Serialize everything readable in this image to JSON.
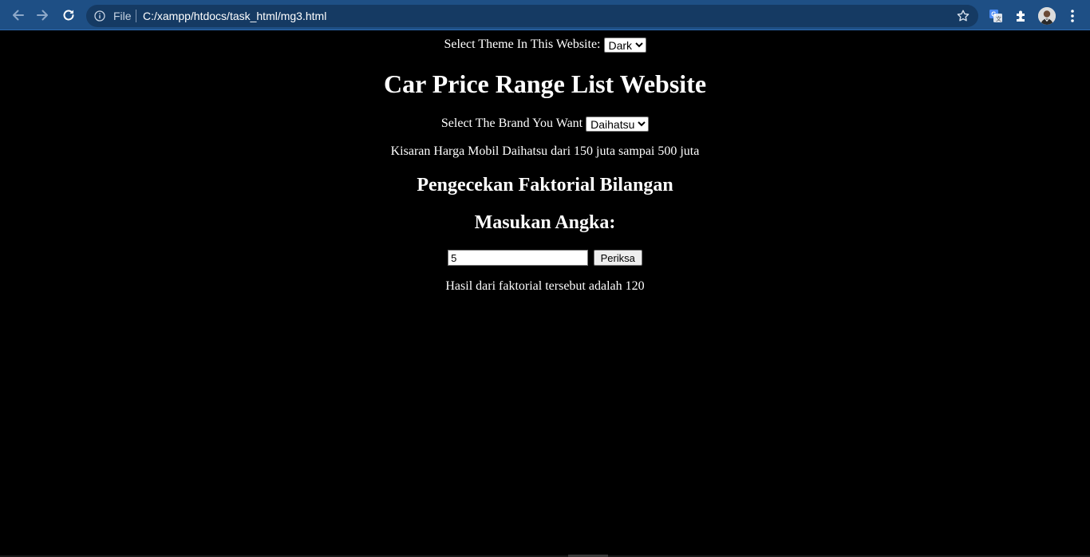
{
  "browser": {
    "scheme_label": "File",
    "url": "C:/xampp/htdocs/task_html/mg3.html",
    "colors": {
      "toolbar": "#1e4f85",
      "omnibox": "#153a63"
    },
    "icons": [
      "back-arrow-icon",
      "forward-arrow-icon",
      "reload-icon",
      "info-icon",
      "star-icon",
      "translate-icon",
      "extensions-puzzle-icon",
      "profile-avatar",
      "more-menu-icon"
    ]
  },
  "page": {
    "background": "#000000",
    "theme": {
      "label": "Select Theme In This Website:",
      "selected": "Dark"
    },
    "title": "Car Price Range List Website",
    "brand": {
      "label": "Select The Brand You Want",
      "selected": "Daihatsu"
    },
    "price_text": "Kisaran Harga Mobil Daihatsu dari 150 juta sampai 500 juta",
    "factorial_title": "Pengecekan Faktorial Bilangan",
    "enter_number_title": "Masukan Angka:",
    "number_input_value": "5",
    "check_button_label": "Periksa",
    "result_text": "Hasil dari faktorial tersebut adalah 120"
  }
}
